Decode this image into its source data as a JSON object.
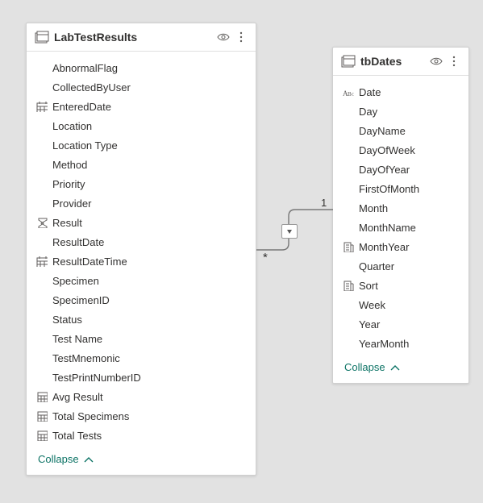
{
  "tables": {
    "left": {
      "title": "LabTestResults",
      "collapse_label": "Collapse",
      "fields": [
        {
          "label": "AbnormalFlag",
          "icon": ""
        },
        {
          "label": "CollectedByUser",
          "icon": ""
        },
        {
          "label": "EnteredDate",
          "icon": "date"
        },
        {
          "label": "Location",
          "icon": ""
        },
        {
          "label": "Location Type",
          "icon": ""
        },
        {
          "label": "Method",
          "icon": ""
        },
        {
          "label": "Priority",
          "icon": ""
        },
        {
          "label": "Provider",
          "icon": ""
        },
        {
          "label": "Result",
          "icon": "sigma"
        },
        {
          "label": "ResultDate",
          "icon": ""
        },
        {
          "label": "ResultDateTime",
          "icon": "date"
        },
        {
          "label": "Specimen",
          "icon": ""
        },
        {
          "label": "SpecimenID",
          "icon": ""
        },
        {
          "label": "Status",
          "icon": ""
        },
        {
          "label": "Test Name",
          "icon": ""
        },
        {
          "label": "TestMnemonic",
          "icon": ""
        },
        {
          "label": "TestPrintNumberID",
          "icon": ""
        },
        {
          "label": "Avg Result",
          "icon": "measure"
        },
        {
          "label": "Total Specimens",
          "icon": "measure"
        },
        {
          "label": "Total Tests",
          "icon": "measure"
        }
      ]
    },
    "right": {
      "title": "tbDates",
      "collapse_label": "Collapse",
      "fields": [
        {
          "label": "Date",
          "icon": "text"
        },
        {
          "label": "Day",
          "icon": ""
        },
        {
          "label": "DayName",
          "icon": ""
        },
        {
          "label": "DayOfWeek",
          "icon": ""
        },
        {
          "label": "DayOfYear",
          "icon": ""
        },
        {
          "label": "FirstOfMonth",
          "icon": ""
        },
        {
          "label": "Month",
          "icon": ""
        },
        {
          "label": "MonthName",
          "icon": ""
        },
        {
          "label": "MonthYear",
          "icon": "hierarchy"
        },
        {
          "label": "Quarter",
          "icon": ""
        },
        {
          "label": "Sort",
          "icon": "hierarchy"
        },
        {
          "label": "Week",
          "icon": ""
        },
        {
          "label": "Year",
          "icon": ""
        },
        {
          "label": "YearMonth",
          "icon": ""
        }
      ]
    }
  },
  "relationship": {
    "many_label": "*",
    "one_label": "1"
  }
}
